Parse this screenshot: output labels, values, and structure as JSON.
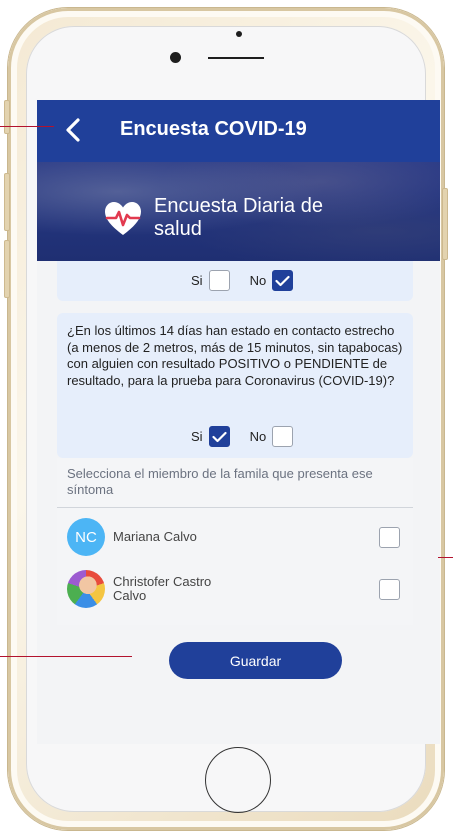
{
  "app": {
    "title": "Encuesta COVID-19",
    "back_icon": "chevron-left-icon"
  },
  "banner": {
    "title": "Encuesta Diaria de salud",
    "icon": "heart-pulse-icon"
  },
  "question_prev": {
    "yes_label": "Si",
    "no_label": "No",
    "yes_checked": false,
    "no_checked": true
  },
  "question_contact": {
    "text": "¿En los últimos 14 días han estado en contacto estrecho (a menos de 2 metros, más de 15 minutos, sin tapabocas) con alguien con resultado POSITIVO o PENDIENTE de resultado, para la prueba para Coronavirus (COVID-19)?",
    "yes_label": "Si",
    "no_label": "No",
    "yes_checked": true,
    "no_checked": false
  },
  "family": {
    "title": "Selecciona el miembro de la famila que presenta ese síntoma",
    "members": [
      {
        "initials": "NC",
        "name": "Mariana Calvo",
        "checked": false
      },
      {
        "initials": "",
        "name": "Christofer Castro Calvo",
        "checked": false
      }
    ]
  },
  "actions": {
    "save_label": "Guardar"
  },
  "colors": {
    "primary": "#20409a",
    "card_bg": "#e6eefb",
    "avatar_nc": "#4cb5f5",
    "annotation": "#b3122e"
  }
}
